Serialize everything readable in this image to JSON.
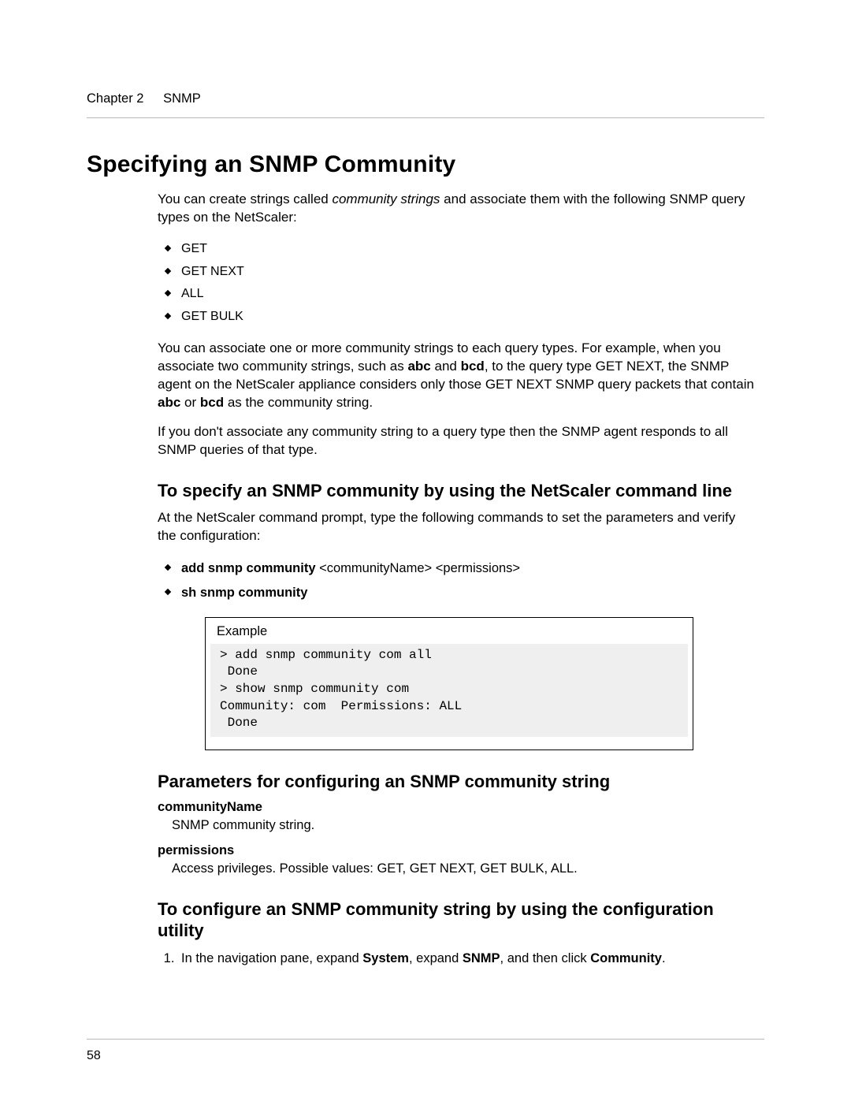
{
  "header": {
    "chapter": "Chapter 2",
    "section": "SNMP"
  },
  "title": "Specifying an SNMP Community",
  "intro1_a": "You can create strings called ",
  "intro1_em": "community strings",
  "intro1_b": " and associate them with the following SNMP query types on the NetScaler:",
  "query_types": [
    "GET",
    "GET NEXT",
    "ALL",
    "GET BULK"
  ],
  "para2_a": "You can associate one or more community strings to each query types. For example, when you associate two community strings, such as ",
  "para2_b1": "abc",
  "para2_c": " and ",
  "para2_b2": "bcd",
  "para2_d": ", to the query type GET NEXT, the SNMP agent on the NetScaler appliance considers only those GET NEXT SNMP query packets that contain ",
  "para2_b3": "abc",
  "para2_e": " or ",
  "para2_b4": "bcd",
  "para2_f": " as the community string.",
  "para3": "If you don't associate any community string to a query type then the SNMP agent responds to all SNMP queries of that type.",
  "sub1": "To specify an SNMP community by using the NetScaler command line",
  "sub1_body": "At the NetScaler command prompt, type the following commands to set the parameters and verify the configuration:",
  "cmd1_bold": "add snmp community",
  "cmd1_rest": " <communityName> <permissions>",
  "cmd2_bold": "sh snmp community",
  "example_label": "Example",
  "example_code": "> add snmp community com all\n Done\n> show snmp community com\nCommunity: com  Permissions: ALL\n Done",
  "sub2": "Parameters for configuring an SNMP community string",
  "params": [
    {
      "name": "communityName",
      "desc": "SNMP community string."
    },
    {
      "name": "permissions",
      "desc": "Access privileges. Possible values: GET, GET NEXT, GET BULK, ALL."
    }
  ],
  "sub3": "To configure an SNMP community string by using the configuration utility",
  "step1_a": "In the navigation pane, expand ",
  "step1_b1": "System",
  "step1_b": ", expand ",
  "step1_b2": "SNMP",
  "step1_c": ", and then click ",
  "step1_b3": "Community",
  "step1_d": ".",
  "page_number": "58"
}
